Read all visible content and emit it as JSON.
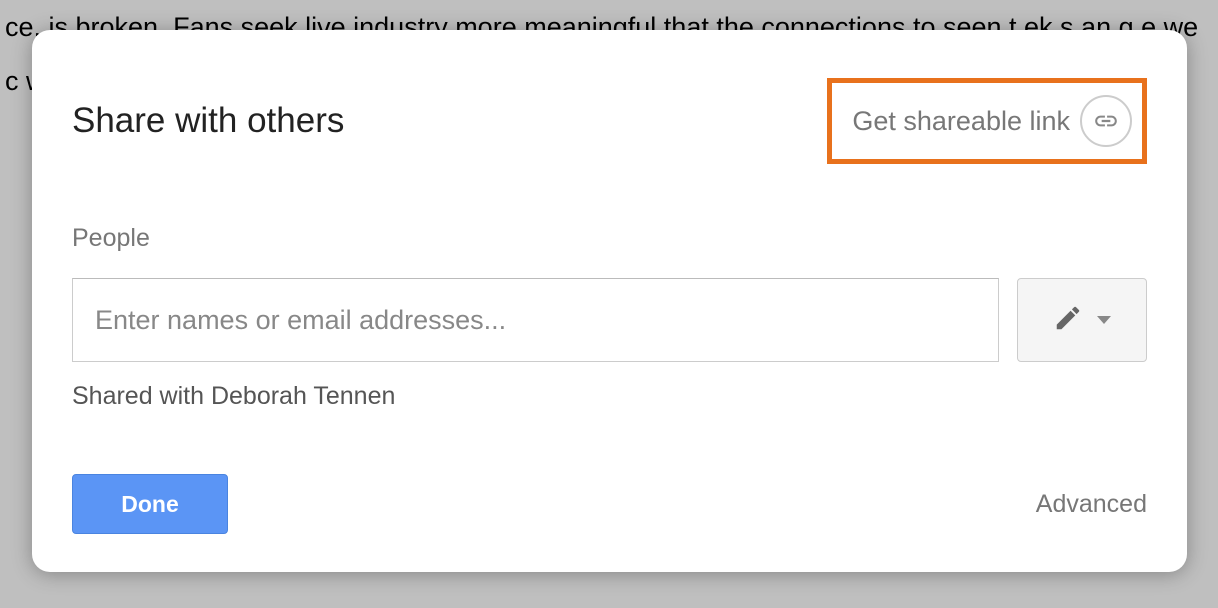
{
  "background": {
    "text": "ce. is broken. Fans seek live industry more meaningful that the connections to seen t ek s an g e we c wh hi un h er"
  },
  "dialog": {
    "title": "Share with others",
    "shareable_link_label": "Get shareable link",
    "people_label": "People",
    "input_placeholder": "Enter names or email addresses...",
    "shared_with": "Shared with Deborah Tennen",
    "done_label": "Done",
    "advanced_label": "Advanced"
  },
  "icons": {
    "link": "link-icon",
    "pencil": "pencil-icon",
    "dropdown": "dropdown-caret"
  }
}
